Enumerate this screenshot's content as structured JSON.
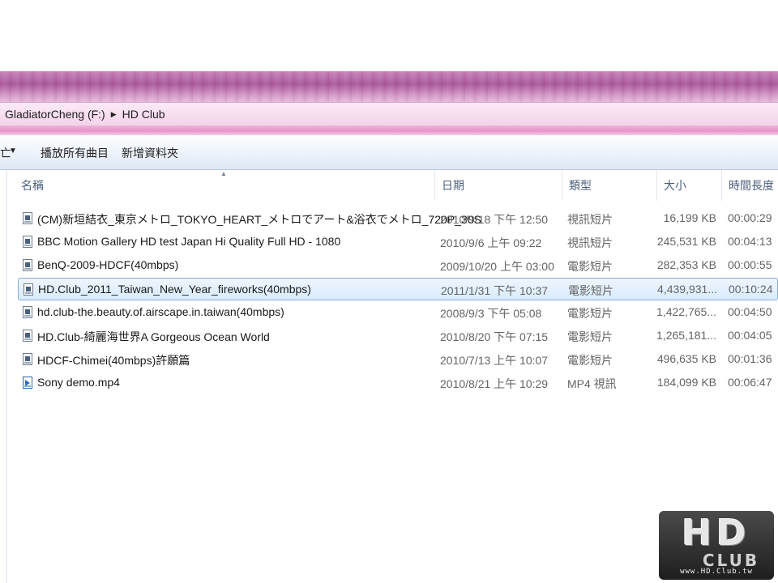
{
  "breadcrumb": [
    "GladiatorCheng (F:)",
    "HD Club"
  ],
  "toolbar": {
    "cut_label": "亡",
    "play_all_label": "播放所有曲目",
    "new_folder_label": "新增資料夾"
  },
  "columns": {
    "name": "名稱",
    "date": "日期",
    "type": "類型",
    "size": "大小",
    "length": "時間長度"
  },
  "files": [
    {
      "name": "(CM)新垣結衣_東京メトロ_TOKYO_HEART_メトロでアート&浴衣でメトロ_720P_30S",
      "date": "2010/9/18 下午 12:50",
      "type": "視訊短片",
      "size": "16,199 KB",
      "length": "00:00:29",
      "icon": "video-file-icon"
    },
    {
      "name": "BBC Motion Gallery HD test Japan Hi Quality Full HD - 1080",
      "date": "2010/9/6 上午 09:22",
      "type": "視訊短片",
      "size": "245,531 KB",
      "length": "00:04:13",
      "icon": "video-file-icon"
    },
    {
      "name": "BenQ-2009-HDCF(40mbps)",
      "date": "2009/10/20 上午 03:00",
      "type": "電影短片",
      "size": "282,353 KB",
      "length": "00:00:55",
      "icon": "video-file-icon"
    },
    {
      "name": "HD.Club_2011_Taiwan_New_Year_fireworks(40mbps)",
      "date": "2011/1/31 下午 10:37",
      "type": "電影短片",
      "size": "4,439,931...",
      "length": "00:10:24",
      "icon": "video-file-icon",
      "selected": true
    },
    {
      "name": "hd.club-the.beauty.of.airscape.in.taiwan(40mbps)",
      "date": "2008/9/3 下午 05:08",
      "type": "電影短片",
      "size": "1,422,765...",
      "length": "00:04:50",
      "icon": "video-file-icon"
    },
    {
      "name": "HD.Club-綺麗海世界A Gorgeous Ocean World",
      "date": "2010/8/20 下午 07:15",
      "type": "電影短片",
      "size": "1,265,181...",
      "length": "00:04:05",
      "icon": "video-file-icon"
    },
    {
      "name": "HDCF-Chimei(40mbps)許願篇",
      "date": "2010/7/13 上午 10:07",
      "type": "電影短片",
      "size": "496,635 KB",
      "length": "00:01:36",
      "icon": "video-file-icon"
    },
    {
      "name": "Sony demo.mp4",
      "date": "2010/8/21 上午 10:29",
      "type": "MP4 視訊",
      "size": "184,099 KB",
      "length": "00:06:47",
      "icon": "mp4-file-icon"
    }
  ],
  "logo": {
    "main": "HD",
    "sub": "CLUB",
    "url": "www.HD.Club.tw"
  },
  "colors": {
    "selection": "#d9ebfc",
    "selection_border": "#84acdd",
    "titlebar": "#a8579a",
    "header_text": "#4c5f7c"
  }
}
